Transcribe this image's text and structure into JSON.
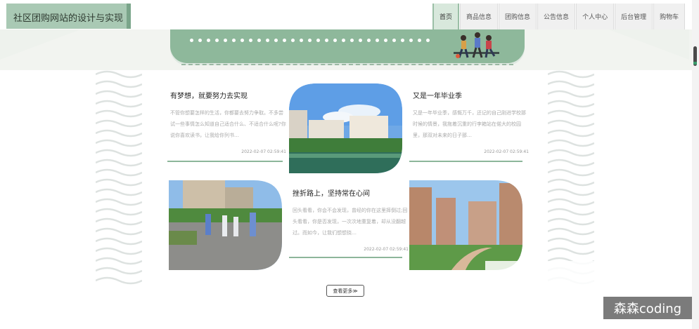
{
  "header": {
    "site_title": "社区团购网站的设计与实现",
    "nav": [
      {
        "label": "首页",
        "active": true
      },
      {
        "label": "商品信息",
        "active": false
      },
      {
        "label": "团购信息",
        "active": false
      },
      {
        "label": "公告信息",
        "active": false
      },
      {
        "label": "个人中心",
        "active": false
      },
      {
        "label": "后台管理",
        "active": false
      },
      {
        "label": "购物车",
        "active": false
      }
    ]
  },
  "news": [
    {
      "title": "有梦想，就要努力去实现",
      "desc": "不管你想要怎样的生活，你都要去努力争取。不多尝试一些事情怎么知道自己适合什么、不适合什么呢?你说你喜欢读书，让我给你列书…",
      "date": "2022-02-07 02:59:41"
    },
    {
      "title": "又是一年毕业季",
      "desc": "又是一年毕业季，感慨万千，还记的自己刚进学校那时候的情景，我拖着沉重的行李箱站在偌大的校园里，那双对未来的日子那…",
      "date": "2022-02-07 02:59:41"
    },
    {
      "title": "挫折路上，坚持常在心间",
      "desc": "回头看看，你会不会发现，曾经的你在这里摔倒过;回头看看，你是否发现，一次次地重复着，却从没翻越过。而如今，让我们想想挠…",
      "date": "2022-02-07 02:59:41"
    }
  ],
  "more_button": "查看更多≫",
  "watermark": "森森coding",
  "colors": {
    "accent": "#8eb89b",
    "logo_bg": "#a9c9b4"
  }
}
